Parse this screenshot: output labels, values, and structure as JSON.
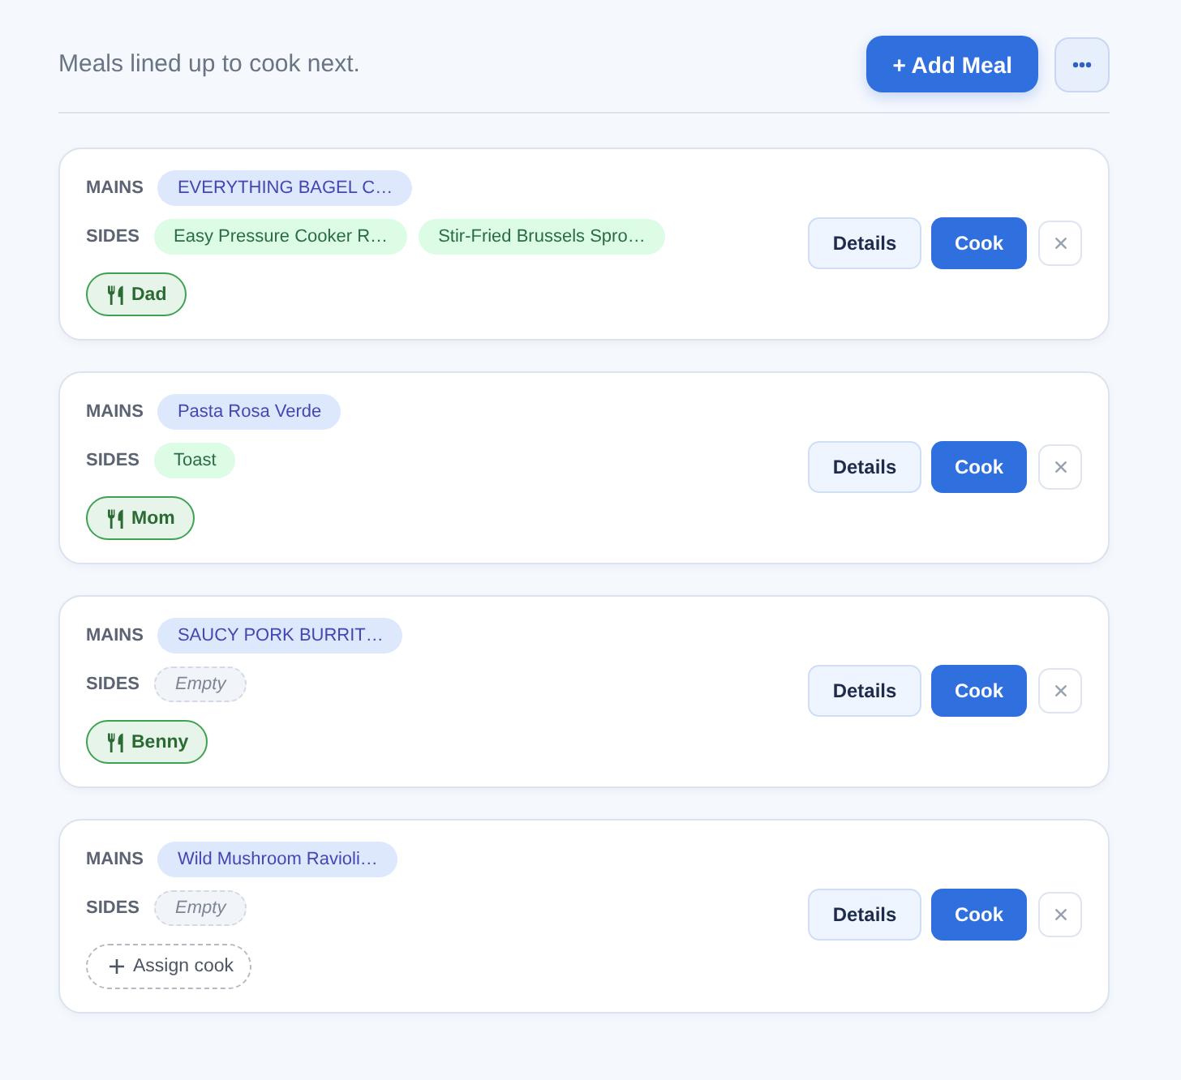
{
  "header": {
    "subtitle": "Meals lined up to cook next.",
    "add_button": "+ Add Meal"
  },
  "meals": [
    {
      "mains": {
        "label": "MAINS",
        "items": [
          {
            "kind": "dish",
            "text": "EVERYTHING BAGEL C…"
          }
        ]
      },
      "sides": {
        "label": "SIDES",
        "items": [
          {
            "kind": "dish",
            "text": "Easy Pressure Cooker R…"
          },
          {
            "kind": "dish",
            "text": "Stir-Fried Brussels Spro…"
          }
        ]
      },
      "cook": {
        "kind": "assigned",
        "text": "Dad"
      },
      "actions": {
        "details": "Details",
        "cook": "Cook"
      }
    },
    {
      "mains": {
        "label": "MAINS",
        "items": [
          {
            "kind": "dish",
            "text": "Pasta Rosa Verde"
          }
        ]
      },
      "sides": {
        "label": "SIDES",
        "items": [
          {
            "kind": "dish",
            "text": "Toast"
          }
        ]
      },
      "cook": {
        "kind": "assigned",
        "text": "Mom"
      },
      "actions": {
        "details": "Details",
        "cook": "Cook"
      }
    },
    {
      "mains": {
        "label": "MAINS",
        "items": [
          {
            "kind": "dish",
            "text": "SAUCY PORK BURRIT…"
          }
        ]
      },
      "sides": {
        "label": "SIDES",
        "items": [
          {
            "kind": "empty",
            "text": "Empty"
          }
        ]
      },
      "cook": {
        "kind": "assigned",
        "text": "Benny"
      },
      "actions": {
        "details": "Details",
        "cook": "Cook"
      }
    },
    {
      "mains": {
        "label": "MAINS",
        "items": [
          {
            "kind": "dish",
            "text": "Wild Mushroom Ravioli…"
          }
        ]
      },
      "sides": {
        "label": "SIDES",
        "items": [
          {
            "kind": "empty",
            "text": "Empty"
          }
        ]
      },
      "cook": {
        "kind": "unassigned",
        "text": "Assign cook"
      },
      "actions": {
        "details": "Details",
        "cook": "Cook"
      }
    }
  ]
}
